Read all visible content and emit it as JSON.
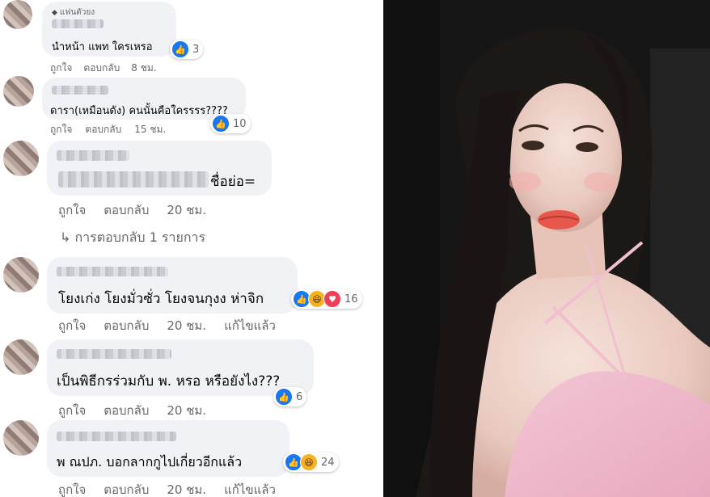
{
  "comments": [
    {
      "badge": "แฟนตัวยง",
      "text": "นำหน้า แพท ใครเหรอ",
      "reactions": [
        "like"
      ],
      "reaction_count": "3",
      "actions": {
        "like": "ถูกใจ",
        "reply": "ตอบกลับ",
        "time": "8 ชม."
      }
    },
    {
      "text": "ดารา(เหมือนดัง) คนนั้นคือใครรรร????",
      "reactions": [
        "like"
      ],
      "reaction_count": "10",
      "actions": {
        "like": "ถูกใจ",
        "reply": "ตอบกลับ",
        "time": "15 ชม."
      }
    },
    {
      "text": "ชื่อย่อ=",
      "actions": {
        "like": "ถูกใจ",
        "reply": "ตอบกลับ",
        "time": "20 ชม."
      },
      "replies_link": "↳ การตอบกลับ 1 รายการ"
    },
    {
      "text": "โยงเก่ง โยงมั่วซั่ว โยงจนกุงง ห่าจิก",
      "reactions": [
        "like",
        "haha",
        "heart"
      ],
      "reaction_count": "16",
      "actions": {
        "like": "ถูกใจ",
        "reply": "ตอบกลับ",
        "time": "20 ชม.",
        "edited": "แก้ไขแล้ว"
      }
    },
    {
      "text": "เป็นพิธีกรร่วมกับ พ. หรอ หรือยังไง???",
      "reactions": [
        "like"
      ],
      "reaction_count": "6",
      "actions": {
        "like": "ถูกใจ",
        "reply": "ตอบกลับ",
        "time": "20 ชม."
      }
    },
    {
      "text": "พ ณปภ. บอกลากกูไปเกี่ยวอีกแล้ว",
      "reactions": [
        "like",
        "haha"
      ],
      "reaction_count": "24",
      "actions": {
        "like": "ถูกใจ",
        "reply": "ตอบกลับ",
        "time": "20 ชม.",
        "edited": "แก้ไขแล้ว"
      }
    }
  ],
  "icons": {
    "like": "like-icon",
    "haha": "haha-icon",
    "heart": "heart-icon",
    "badge": "diamond-icon"
  },
  "colors": {
    "like": "#1877f2",
    "haha": "#f7b125",
    "heart": "#f33e58",
    "bubble": "#f0f2f5",
    "meta": "#65676b"
  }
}
